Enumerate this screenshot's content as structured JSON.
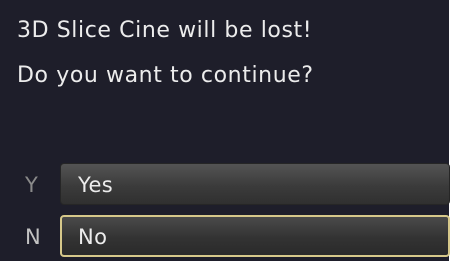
{
  "dialog": {
    "message_line1": "3D Slice Cine will be lost!",
    "message_line2": "Do you want to continue?",
    "options": [
      {
        "key": "Y",
        "label": "Yes",
        "selected": false
      },
      {
        "key": "N",
        "label": "No",
        "selected": true
      }
    ]
  },
  "colors": {
    "background": "#1e1e2a",
    "text": "#ececec",
    "hotkey": "#8a8a8a",
    "selected_border": "#d6c88a"
  }
}
